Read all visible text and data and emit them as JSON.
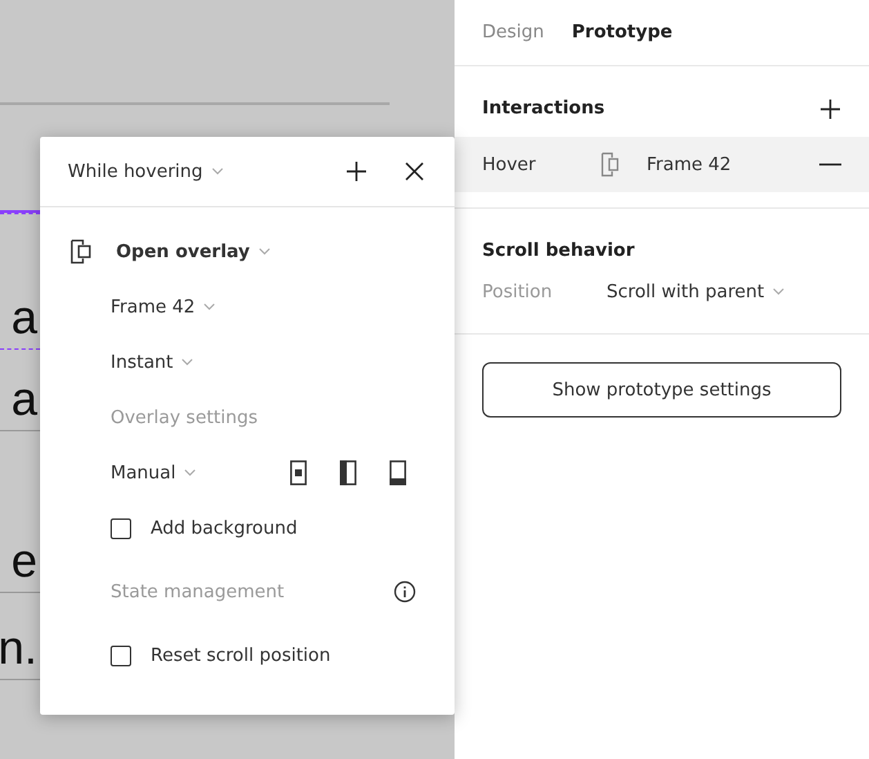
{
  "canvas": {
    "texts": [
      "a",
      "a",
      "e",
      "n."
    ]
  },
  "popup": {
    "trigger": "While hovering",
    "action": "Open overlay",
    "destination": "Frame 42",
    "animation": "Instant",
    "overlay_settings": "Overlay settings",
    "position": "Manual",
    "background": {
      "label": "Add background",
      "checked": false
    },
    "state_management": "State management",
    "reset_scroll": {
      "label": "Reset scroll position",
      "checked": false
    }
  },
  "panel": {
    "tabs": [
      {
        "label": "Design",
        "selected": false
      },
      {
        "label": "Prototype",
        "selected": true
      }
    ],
    "interactions": {
      "title": "Interactions",
      "items": [
        {
          "trigger": "Hover",
          "target": "Frame 42",
          "selected": true
        }
      ]
    },
    "scroll_behavior": {
      "title": "Scroll behavior",
      "label": "Position",
      "value": "Scroll with parent"
    },
    "button": "Show prototype settings"
  }
}
